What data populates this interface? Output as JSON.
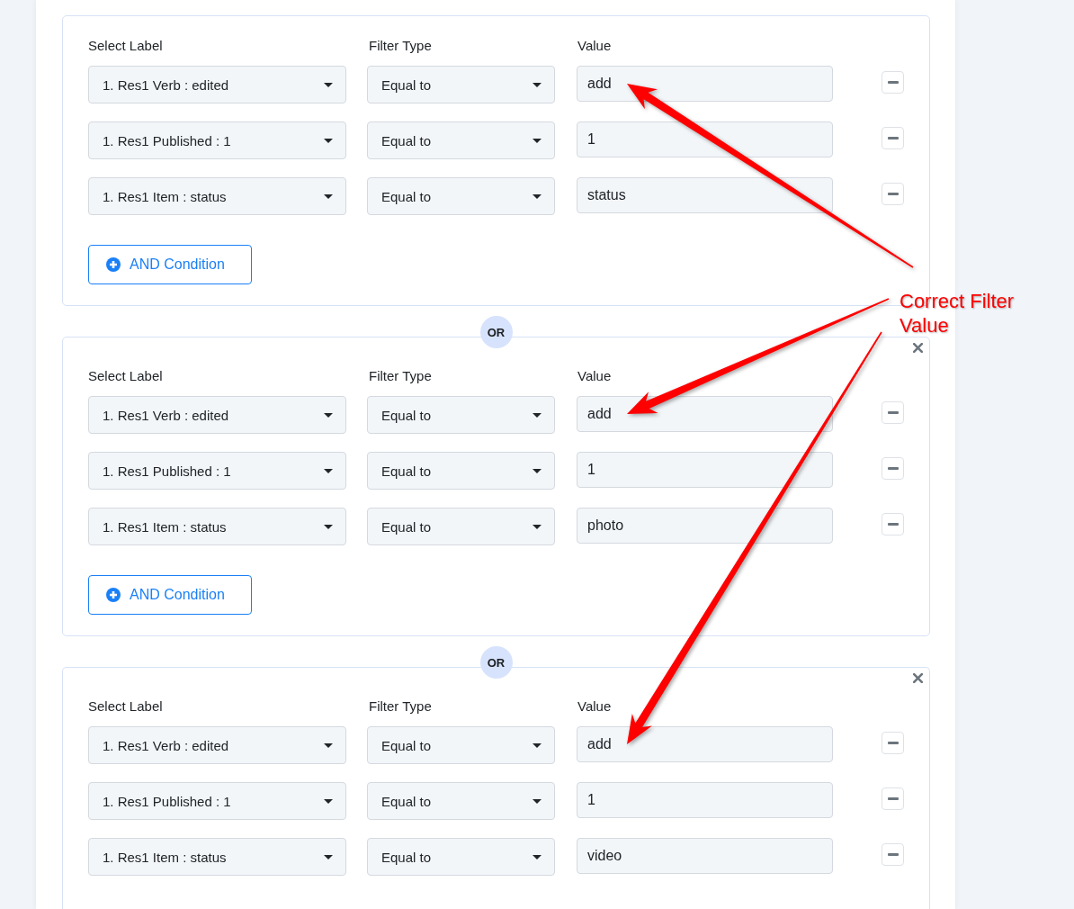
{
  "groups": [
    {
      "closable": false,
      "headers": {
        "label": "Select Label",
        "filter_type": "Filter Type",
        "value": "Value"
      },
      "conditions": [
        {
          "label": "1. Res1 Verb : edited",
          "filter_type": "Equal to",
          "value": "add",
          "pointed_at": true
        },
        {
          "label": "1. Res1 Published : 1",
          "filter_type": "Equal to",
          "value": "1",
          "pointed_at": false
        },
        {
          "label": "1. Res1 Item : status",
          "filter_type": "Equal to",
          "value": "status",
          "pointed_at": false
        }
      ],
      "add_button": "AND Condition"
    },
    {
      "join_label": "OR",
      "closable": true,
      "headers": {
        "label": "Select Label",
        "filter_type": "Filter Type",
        "value": "Value"
      },
      "conditions": [
        {
          "label": "1. Res1 Verb : edited",
          "filter_type": "Equal to",
          "value": "add",
          "pointed_at": true
        },
        {
          "label": "1. Res1 Published : 1",
          "filter_type": "Equal to",
          "value": "1",
          "pointed_at": false
        },
        {
          "label": "1. Res1 Item : status",
          "filter_type": "Equal to",
          "value": "photo",
          "pointed_at": false
        }
      ],
      "add_button": "AND Condition"
    },
    {
      "join_label": "OR",
      "closable": true,
      "headers": {
        "label": "Select Label",
        "filter_type": "Filter Type",
        "value": "Value"
      },
      "conditions": [
        {
          "label": "1. Res1 Verb : edited",
          "filter_type": "Equal to",
          "value": "add",
          "pointed_at": true
        },
        {
          "label": "1. Res1 Published : 1",
          "filter_type": "Equal to",
          "value": "1",
          "pointed_at": false
        },
        {
          "label": "1. Res1 Item : status",
          "filter_type": "Equal to",
          "value": "video",
          "pointed_at": false
        }
      ]
    }
  ],
  "annotation": {
    "text": "Correct Filter Value"
  }
}
